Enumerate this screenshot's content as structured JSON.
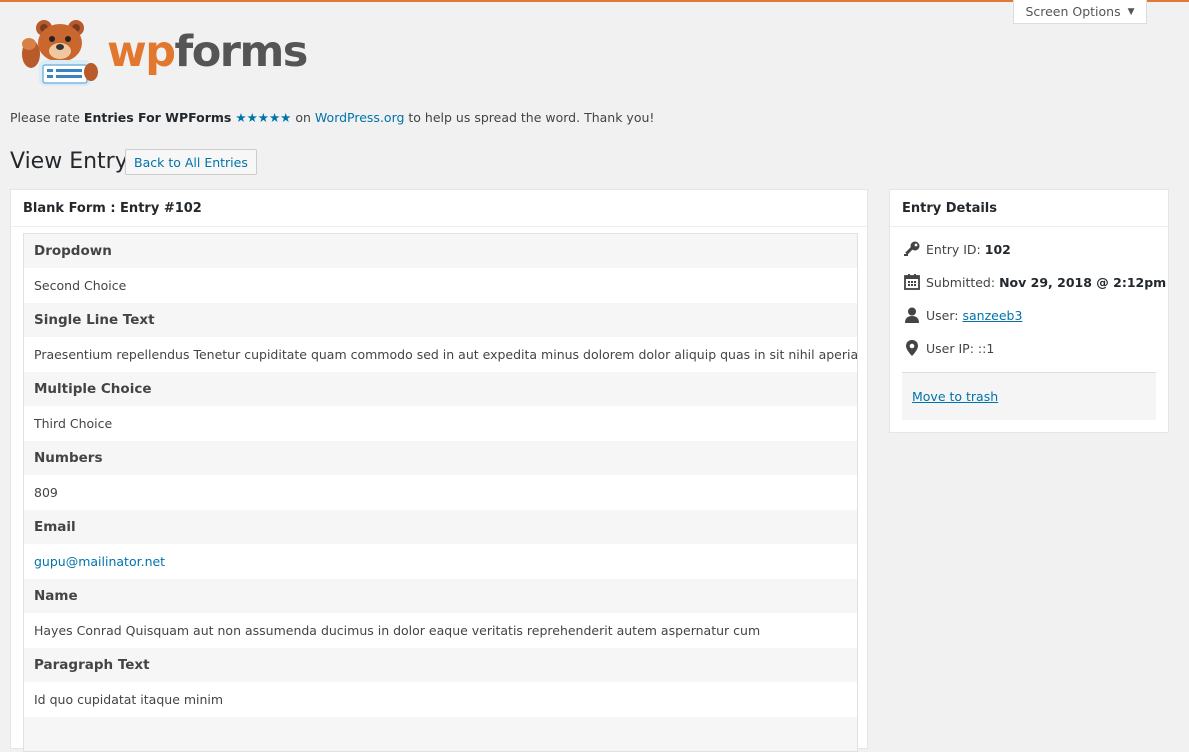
{
  "header": {
    "screen_options_label": "Screen Options",
    "logo_text_wp": "wp",
    "logo_text_forms": "forms"
  },
  "rate_notice": {
    "prefix": "Please rate ",
    "product": "Entries For WPForms",
    "stars": "★★★★★",
    "middle": " on ",
    "site_link": "WordPress.org",
    "suffix": " to help us spread the word. Thank you!"
  },
  "page": {
    "title": "View Entry",
    "back_button": "Back to All Entries"
  },
  "entry": {
    "header": "Blank Form : Entry #102",
    "fields": [
      {
        "name": "Dropdown",
        "value": "Second Choice"
      },
      {
        "name": "Single Line Text",
        "value": "Praesentium repellendus Tenetur cupiditate quam commodo sed in aut expedita minus dolorem dolor aliquip quas in sit nihil aperiam"
      },
      {
        "name": "Multiple Choice",
        "value": "Third Choice"
      },
      {
        "name": "Numbers",
        "value": "809"
      },
      {
        "name": "Email",
        "value": "gupu@mailinator.net"
      },
      {
        "name": "Name",
        "value": "Hayes Conrad Quisquam aut non assumenda ducimus in dolor eaque veritatis reprehenderit autem aspernatur cum"
      },
      {
        "name": "Paragraph Text",
        "value": "Id quo cupidatat itaque minim"
      }
    ]
  },
  "details": {
    "header": "Entry Details",
    "entry_id_label": "Entry ID:",
    "entry_id_value": "102",
    "submitted_label": "Submitted:",
    "submitted_value": "Nov 29, 2018 @ 2:12pm",
    "user_label": "User:",
    "user_value": "sanzeeb3",
    "ip_label": "User IP:",
    "ip_value": "::1",
    "trash_link": "Move to trash"
  },
  "colors": {
    "accent": "#e27730",
    "link": "#0073aa",
    "background": "#f1f1f1"
  }
}
